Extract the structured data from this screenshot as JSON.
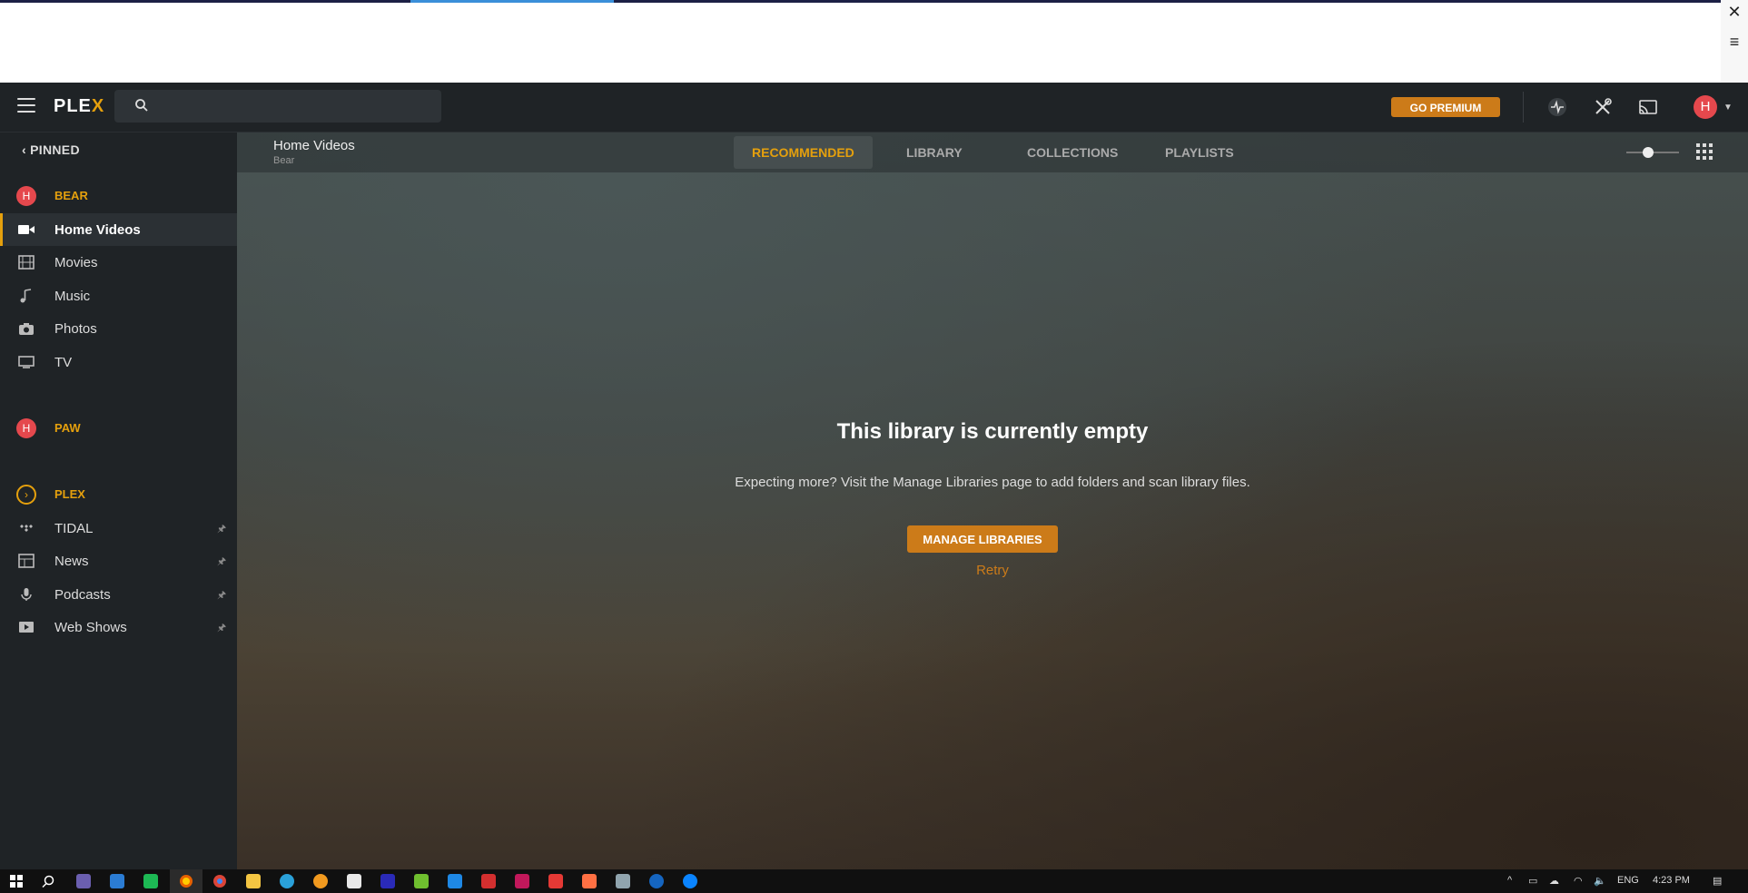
{
  "topbar": {
    "logo_main": "PLE",
    "logo_x": "X",
    "premium_label": "GO PREMIUM",
    "avatar_letter": "H"
  },
  "sidebar": {
    "pinned_label": "PINNED",
    "servers": [
      {
        "avatar": "H",
        "name": "BEAR"
      },
      {
        "avatar": "H",
        "name": "PAW"
      },
      {
        "avatar": "›",
        "name": "PLEX"
      }
    ],
    "bear_items": [
      {
        "label": "Home Videos",
        "icon": "video-camera-icon",
        "active": true
      },
      {
        "label": "Movies",
        "icon": "film-icon"
      },
      {
        "label": "Music",
        "icon": "music-note-icon"
      },
      {
        "label": "Photos",
        "icon": "camera-icon"
      },
      {
        "label": "TV",
        "icon": "tv-icon"
      }
    ],
    "plex_items": [
      {
        "label": "TIDAL",
        "icon": "tidal-icon",
        "pin": "🖈"
      },
      {
        "label": "News",
        "icon": "news-icon",
        "pin": "🖈"
      },
      {
        "label": "Podcasts",
        "icon": "microphone-icon",
        "pin": "🖈"
      },
      {
        "label": "Web Shows",
        "icon": "play-icon",
        "pin": "🖈"
      }
    ]
  },
  "main": {
    "library_title": "Home Videos",
    "library_server": "Bear",
    "tabs": [
      "RECOMMENDED",
      "LIBRARY",
      "COLLECTIONS",
      "PLAYLISTS"
    ],
    "active_tab": "RECOMMENDED",
    "empty_title": "This library is currently empty",
    "empty_text": "Expecting more? Visit the Manage Libraries page to add folders and scan library files.",
    "manage_button": "MANAGE LIBRARIES",
    "retry_label": "Retry"
  },
  "taskbar": {
    "language": "ENG",
    "time": "4:23 PM"
  },
  "colors": {
    "accent": "#e5a00d",
    "button": "#cc7b19",
    "avatar": "#e5484d"
  }
}
